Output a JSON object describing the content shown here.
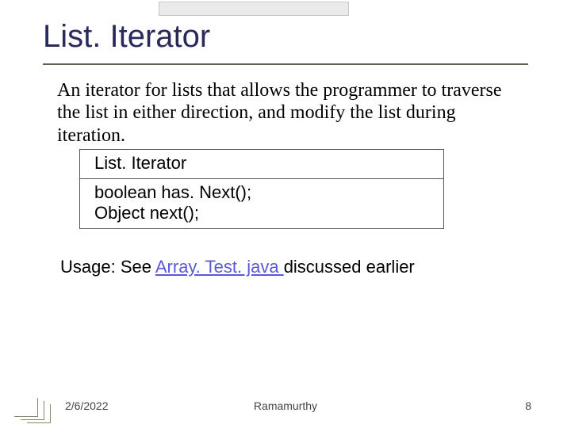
{
  "title": "List. Iterator",
  "body": "An iterator for lists that allows the programmer to traverse the list in either direction, and modify the list during iteration.",
  "uml": {
    "name": "List. Iterator",
    "methods_line1": "boolean has. Next();",
    "methods_line2": "Object next();"
  },
  "usage": {
    "prefix": "Usage: See ",
    "link": "Array. Test. java ",
    "suffix": "discussed earlier"
  },
  "footer": {
    "date": "2/6/2022",
    "author": "Ramamurthy",
    "page": "8"
  }
}
